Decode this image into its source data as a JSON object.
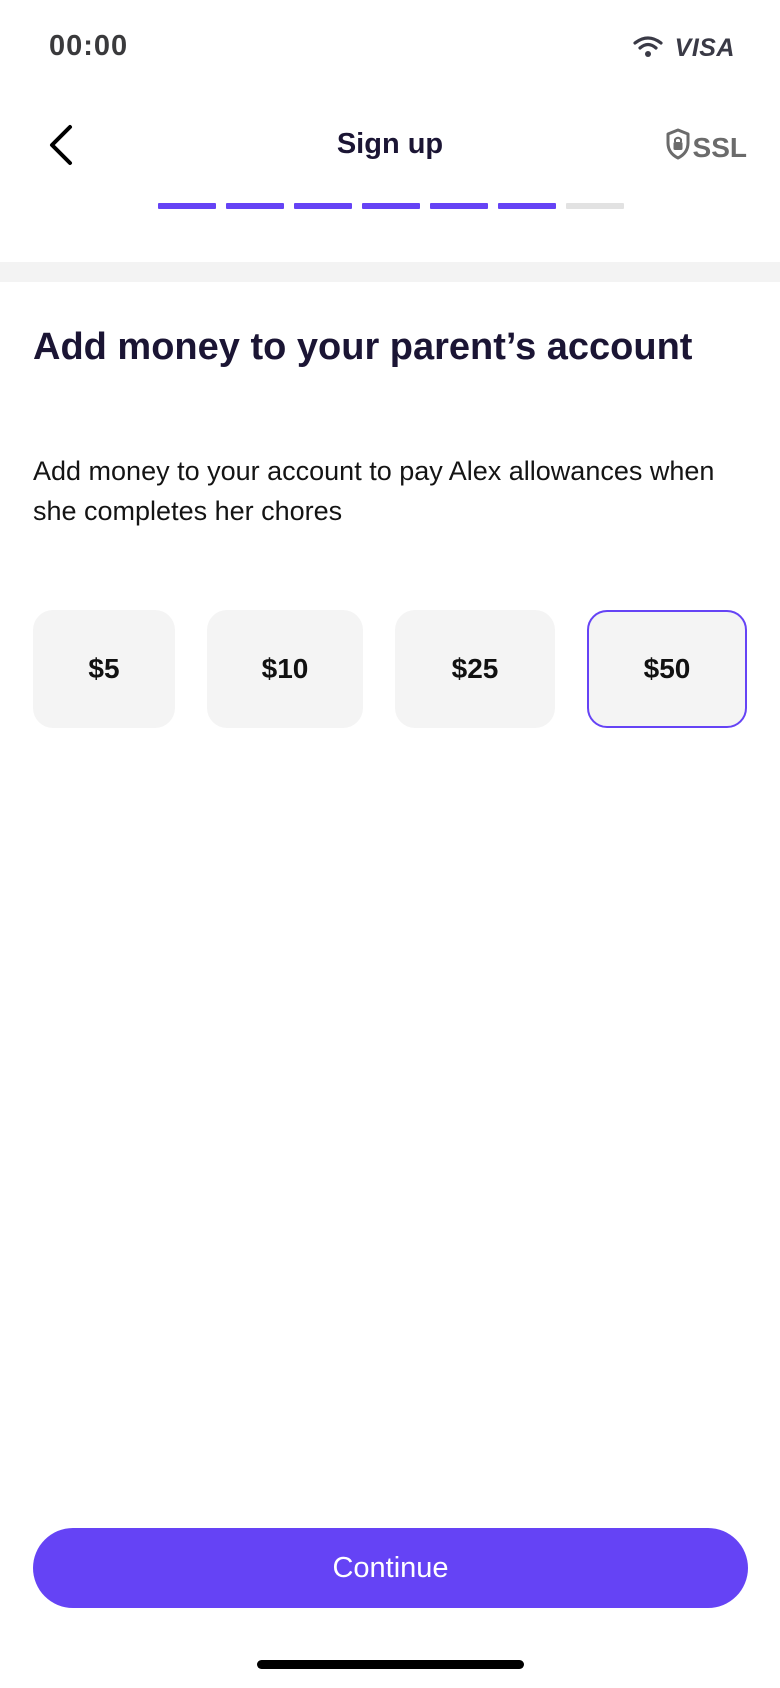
{
  "status_bar": {
    "time": "00:00",
    "wifi_icon": "wifi-icon",
    "carrier_logo": "VISA"
  },
  "nav": {
    "back_icon": "chevron-left-icon",
    "title": "Sign up",
    "ssl_icon": "shield-lock-icon",
    "ssl_label": "SSL"
  },
  "progress": {
    "completed_steps": 6,
    "total_steps": 7,
    "active_color": "#6543f5",
    "inactive_color": "#e2e2e2"
  },
  "main": {
    "title": "Add money to your parent’s account",
    "description": "Add money to your account to pay Alex allowances when she completes her chores",
    "amounts": [
      {
        "label": "$5",
        "selected": false
      },
      {
        "label": "$10",
        "selected": false
      },
      {
        "label": "$25",
        "selected": false
      },
      {
        "label": "$50",
        "selected": true
      }
    ]
  },
  "footer": {
    "continue_label": "Continue"
  },
  "colors": {
    "accent": "#6543f5",
    "title_text": "#1b1534"
  }
}
